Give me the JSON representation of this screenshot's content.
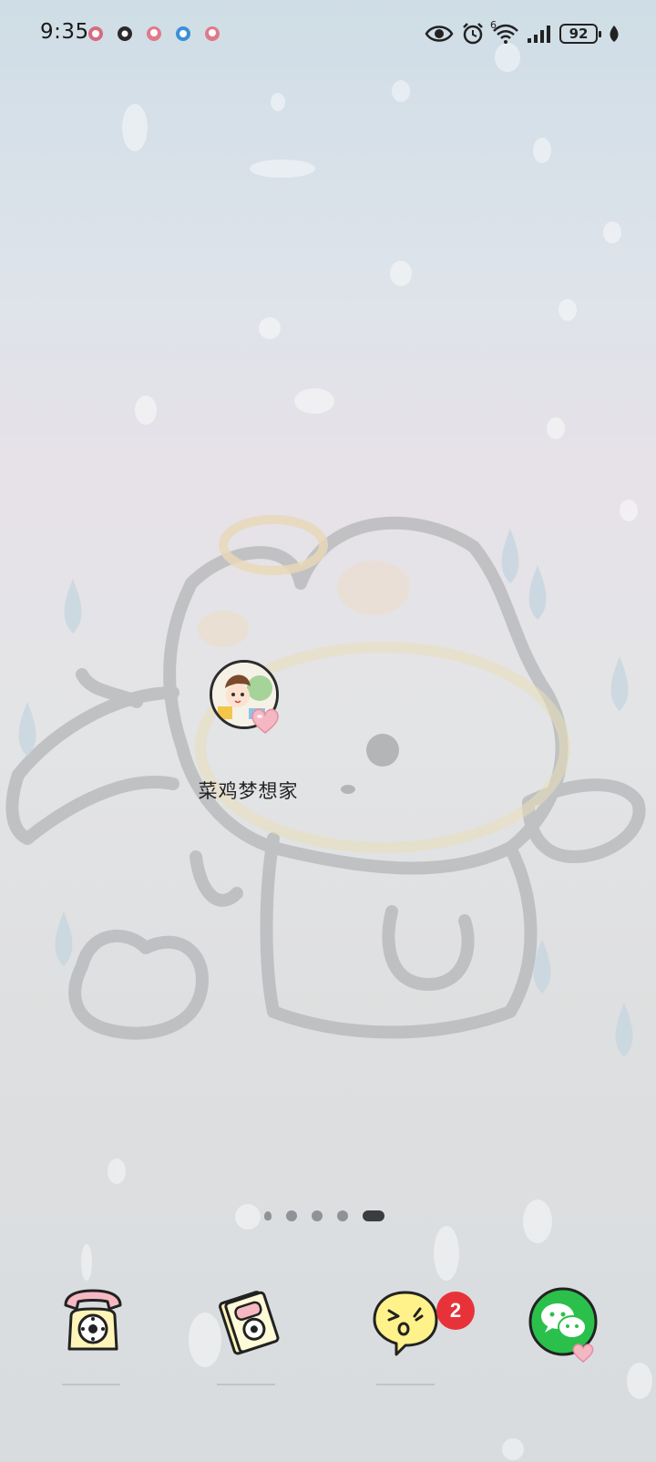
{
  "status_bar": {
    "time": "9:35",
    "battery_level": "92",
    "network_label": "6",
    "notification_icons": [
      "app-notification-icon",
      "app-notification-icon",
      "app-notification-icon",
      "app-notification-icon",
      "app-notification-icon"
    ],
    "system_icons": [
      "eye-icon",
      "alarm-icon",
      "wifi-icon",
      "signal-icon",
      "battery-icon",
      "leaf-icon"
    ]
  },
  "home": {
    "apps": [
      {
        "label": "菜鸡梦想家",
        "icon": "avatar-app-icon"
      }
    ],
    "page_indicator": {
      "pages": 5,
      "current": 5
    }
  },
  "dock": {
    "items": [
      {
        "name": "phone",
        "icon": "phone-icon"
      },
      {
        "name": "contacts",
        "icon": "contacts-icon"
      },
      {
        "name": "messages",
        "icon": "messages-icon",
        "badge": "2"
      },
      {
        "name": "wechat",
        "icon": "wechat-icon"
      }
    ]
  },
  "colors": {
    "badge": "#e8323a",
    "wechat_green": "#2bc04b",
    "heart_pink": "#f4b8c4"
  }
}
